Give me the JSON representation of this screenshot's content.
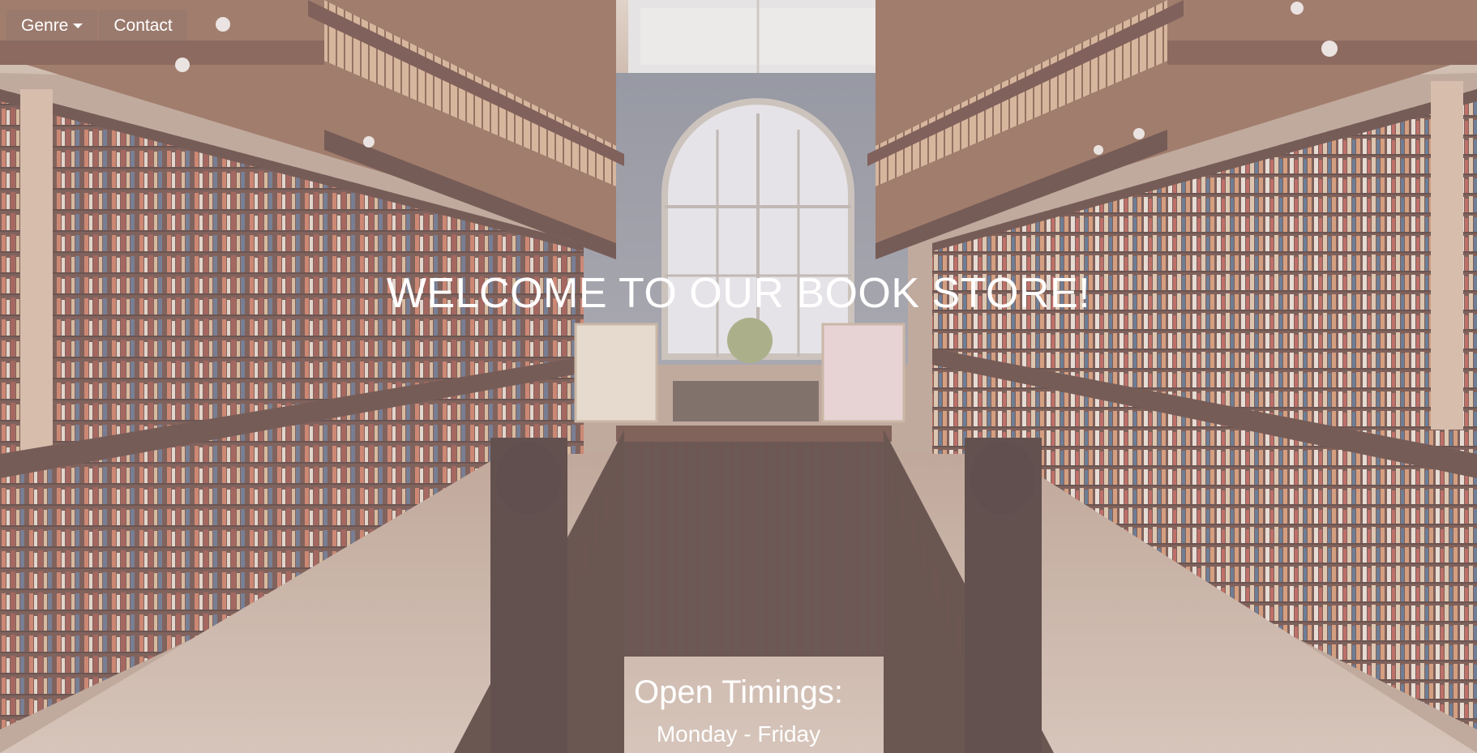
{
  "navbar": {
    "items": [
      {
        "label": "Genre",
        "has_dropdown": true,
        "icon": "caret-down-icon"
      },
      {
        "label": "Contact",
        "has_dropdown": false
      }
    ]
  },
  "hero": {
    "background": "library-bookstore-interior-photo",
    "heading": "WELCOME TO OUR BOOK STORE!",
    "timings_title": "Open Timings:",
    "timings_days": "Monday - Friday"
  },
  "colors": {
    "text": "#ffffff",
    "overlay_tint": "#d2c8cd",
    "wood_dark": "#4a2c22",
    "wood_light": "#b8825a",
    "floor": "#c8b09a"
  }
}
